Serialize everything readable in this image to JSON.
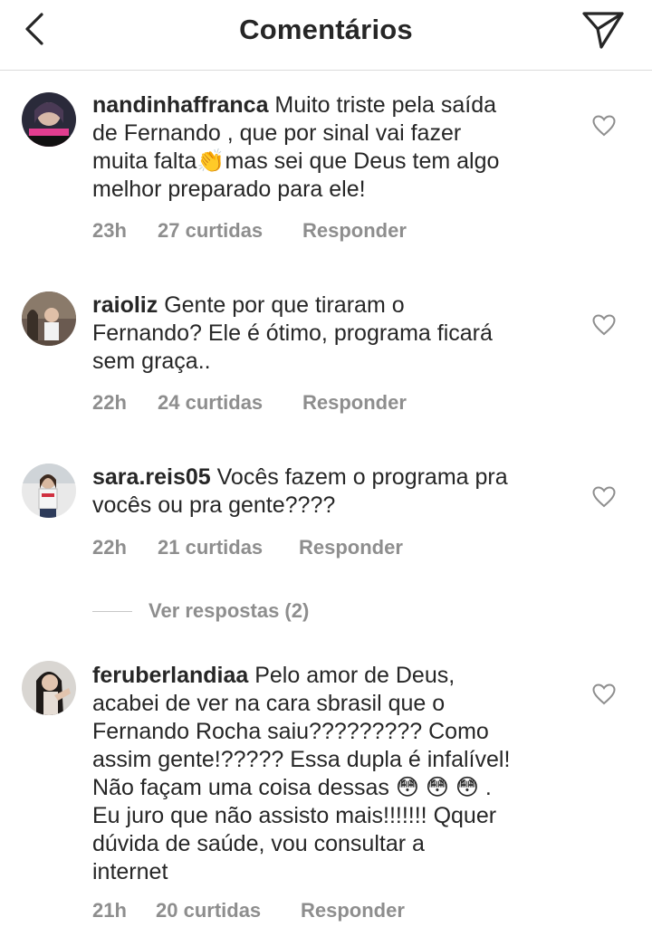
{
  "header": {
    "title": "Comentários",
    "back_icon": "chevron-left-icon",
    "send_icon": "paper-plane-icon"
  },
  "comments": [
    {
      "username": "nandinhaffranca",
      "text": " Muito triste pela saída\nde Fernando , que por sinal vai fazer\nmuita falta👏mas sei que Deus tem algo\nmelhor preparado para ele!",
      "time": "23h",
      "likes": "27 curtidas",
      "reply": "Responder"
    },
    {
      "username": "raioliz",
      "text": " Gente por que tiraram o\nFernando? Ele é ótimo, programa ficará\nsem graça..",
      "time": "22h",
      "likes": "24 curtidas",
      "reply": "Responder"
    },
    {
      "username": "sara.reis05",
      "text": " Vocês fazem o programa pra\nvocês ou pra gente????",
      "time": "22h",
      "likes": "21 curtidas",
      "reply": "Responder",
      "view_replies": "Ver respostas (2)"
    },
    {
      "username": "feruberlandiaa",
      "text": " Pelo amor de Deus,\nacabei de ver na cara sbrasil que o\nFernando Rocha saiu????????? Como\nassim gente!????? Essa dupla é infalível!\nNão façam uma coisa dessas 😳 😳 😳 .\nEu juro que não assisto mais!!!!!!! Qquer\ndúvida de saúde, vou consultar a\ninternet",
      "time": "21h",
      "likes": "20 curtidas",
      "reply": "Responder"
    }
  ],
  "colors": {
    "text": "#262626",
    "meta": "#8e8e8e",
    "divider": "#dbdbdb"
  }
}
